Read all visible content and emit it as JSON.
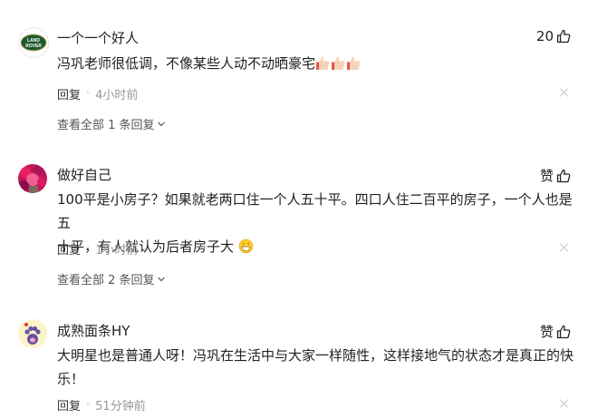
{
  "comments": [
    {
      "username": "一个一个好人",
      "avatar": "land-rover-logo",
      "avatar_text": "LAND ROVER",
      "like_label": "20",
      "content": "冯巩老师很低调，不像某些人动不动晒豪宅",
      "reaction_icons": [
        "thumbs-up-emoji",
        "thumbs-up-emoji",
        "thumbs-up-emoji"
      ],
      "reply_label": "回复",
      "separator": "·",
      "time": "4小时前",
      "view_all": "查看全部 1 条回复"
    },
    {
      "username": "做好自己",
      "avatar": "flowers-photo",
      "like_label": "赞",
      "content_line1": "100平是小房子？如果就老两口住一个人五十平。四口人住二百平的房子，一个人也是五",
      "content_line2": "十平，有人就认为后者房子大",
      "reaction_icons": [
        "grinning-emoji"
      ],
      "reply_label": "回复",
      "separator": "·",
      "time": "1小时前",
      "view_all": "查看全部 2 条回复"
    },
    {
      "username": "成熟面条HY",
      "avatar": "cat-paw-avatar",
      "like_label": "赞",
      "content_line1": "大明星也是普通人呀！冯巩在生活中与大家一样随性，这样接地气的状态才是真正的快",
      "content_line2": "乐！",
      "reply_label": "回复",
      "separator": "·",
      "time": "51分钟前"
    }
  ],
  "colors": {
    "accent": "#222222",
    "muted": "#999999",
    "divider": "#c8c8c8"
  }
}
